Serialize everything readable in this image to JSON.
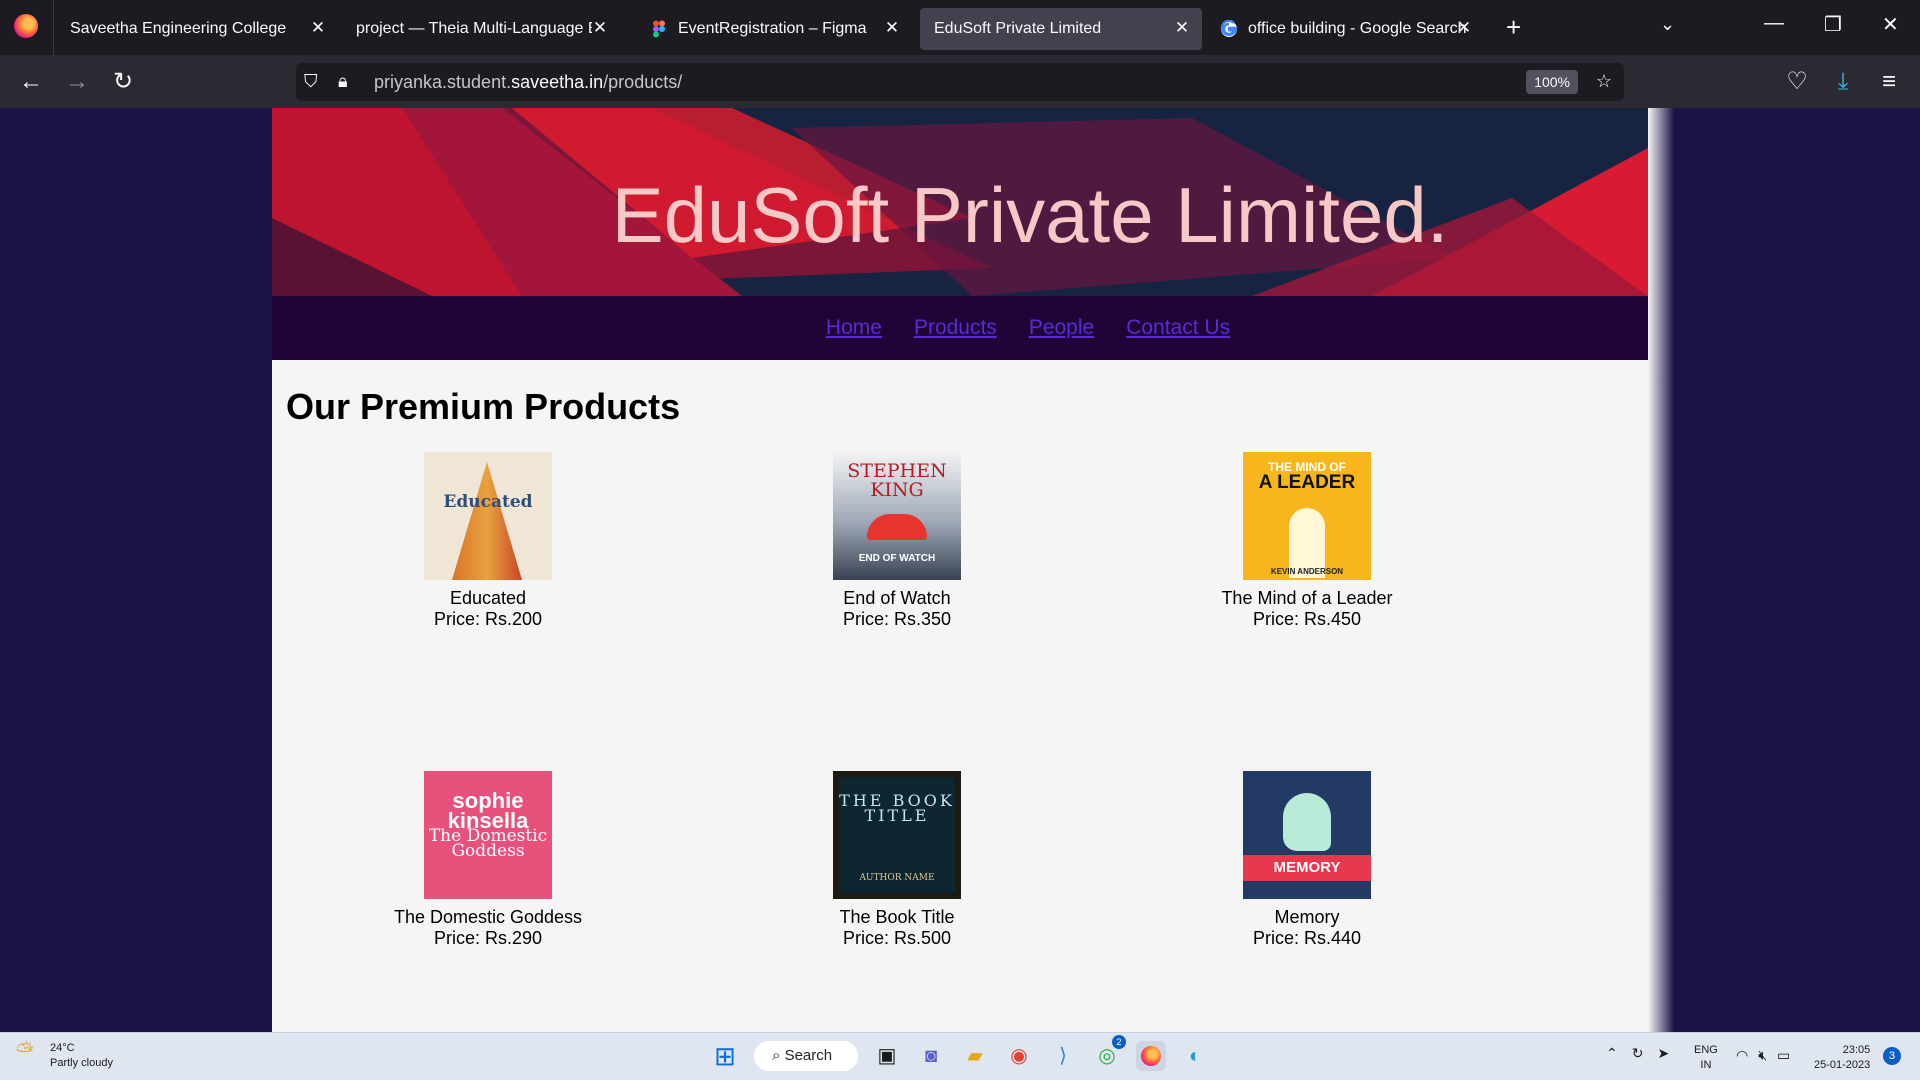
{
  "browser": {
    "tabs": [
      {
        "title": "Saveetha Engineering College",
        "active": false
      },
      {
        "title": "project — Theia Multi-Language Exa",
        "active": false
      },
      {
        "title": "EventRegistration – Figma",
        "active": false
      },
      {
        "title": "EduSoft Private Limited",
        "active": true
      },
      {
        "title": "office building - Google Search",
        "active": false
      }
    ],
    "url_prefix": "priyanka.student.",
    "url_domain": "saveetha.in",
    "url_path": "/products/",
    "zoom": "100%"
  },
  "site": {
    "title": "EduSoft Private Limited.",
    "nav": [
      "Home",
      "Products",
      "People",
      "Contact Us"
    ],
    "section_title": "Our Premium Products",
    "products": [
      {
        "name": "Educated",
        "price": "Price: Rs.200",
        "cover_text": "Educated"
      },
      {
        "name": "End of Watch",
        "price": "Price: Rs.350",
        "cover_text": "STEPHEN KING",
        "cover_subtext": "END OF WATCH"
      },
      {
        "name": "The Mind of a Leader",
        "price": "Price: Rs.450",
        "cover_text": "THE MIND OF",
        "cover_subtext": "A LEADER",
        "cover_author": "KEVIN ANDERSON"
      },
      {
        "name": "The Domestic Goddess",
        "price": "Price: Rs.290",
        "cover_text": "sophie kinsella",
        "cover_subtext": "The Domestic Goddess"
      },
      {
        "name": "The Book Title",
        "price": "Price: Rs.500",
        "cover_text": "THE BOOK TITLE",
        "cover_subtext": "AUTHOR NAME"
      },
      {
        "name": "Memory",
        "price": "Price: Rs.440",
        "cover_text": "MEMORY"
      }
    ],
    "colors": {
      "nav_link": "#5a2ad6",
      "nav_bg": "#200438",
      "title": "#f6c9c6"
    }
  },
  "taskbar": {
    "temperature": "24°C",
    "weather": "Partly cloudy",
    "search_label": "Search",
    "lang_1": "ENG",
    "lang_2": "IN",
    "time": "23:05",
    "date": "25-01-2023",
    "notifications": "3",
    "whatsapp_badge": "2"
  }
}
